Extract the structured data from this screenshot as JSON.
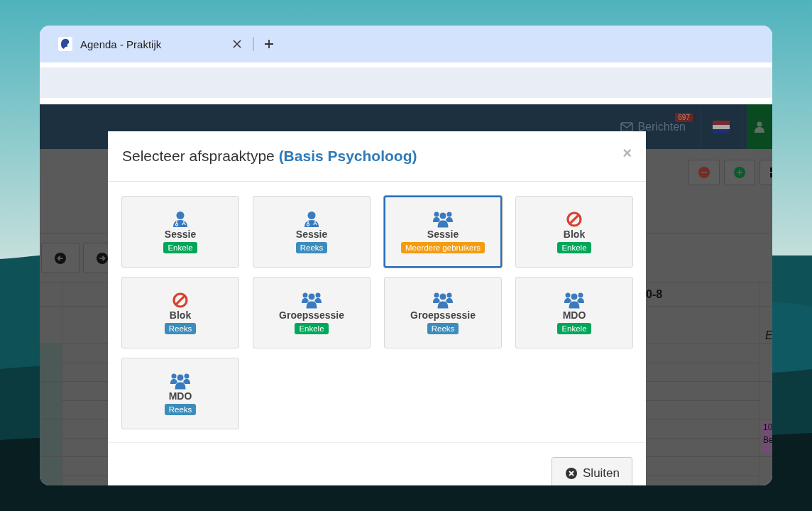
{
  "window": {
    "tab_title": "Agenda - Praktijk"
  },
  "app_header": {
    "messages_label": "Berichten",
    "messages_count": "697"
  },
  "calendar": {
    "column_heading": "0-8",
    "row_text": "E",
    "event": {
      "time": "10",
      "title": "Be"
    }
  },
  "modal": {
    "title": "Selecteer afspraaktype",
    "subtitle": "(Basis Psycholoog)",
    "close": "×",
    "options": [
      {
        "kind": "doctor",
        "label": "Sessie",
        "badge": "Enkele",
        "color": "#00a65a",
        "selected": false
      },
      {
        "kind": "doctor",
        "label": "Sessie",
        "badge": "Reeks",
        "color": "#3c8dbc",
        "selected": false
      },
      {
        "kind": "group",
        "label": "Sessie",
        "badge": "Meerdere gebruikers",
        "color": "#f39c12",
        "selected": true
      },
      {
        "kind": "ban",
        "label": "Blok",
        "badge": "Enkele",
        "color": "#00a65a",
        "selected": false
      },
      {
        "kind": "ban",
        "label": "Blok",
        "badge": "Reeks",
        "color": "#3c8dbc",
        "selected": false
      },
      {
        "kind": "group",
        "label": "Groepssessie",
        "badge": "Enkele",
        "color": "#00a65a",
        "selected": false
      },
      {
        "kind": "group",
        "label": "Groepssessie",
        "badge": "Reeks",
        "color": "#3c8dbc",
        "selected": false
      },
      {
        "kind": "group",
        "label": "MDO",
        "badge": "Enkele",
        "color": "#00a65a",
        "selected": false
      },
      {
        "kind": "group",
        "label": "MDO",
        "badge": "Reeks",
        "color": "#3c8dbc",
        "selected": false
      }
    ],
    "close_button": "Sluiten"
  }
}
